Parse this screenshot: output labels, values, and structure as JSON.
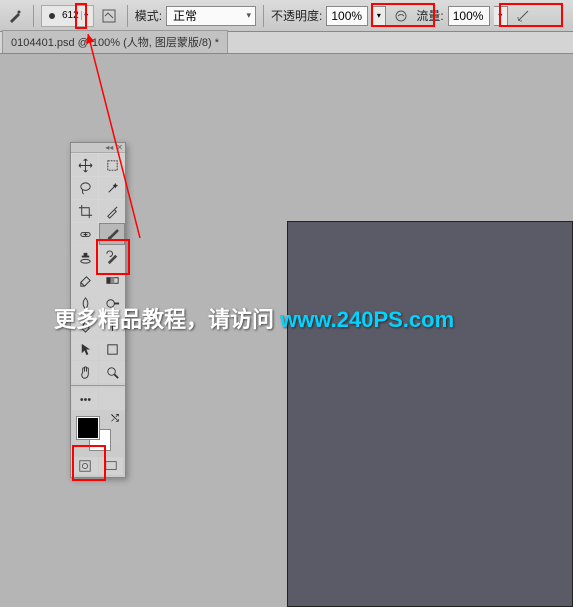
{
  "toolbar": {
    "brush_size": "612",
    "mode_label": "模式:",
    "mode_value": "正常",
    "opacity_label": "不透明度:",
    "opacity_value": "100%",
    "flow_label": "流量:",
    "flow_value": "100%"
  },
  "tab": {
    "title": "0104401.psd @ 100% (人物, 图层蒙版/8) *"
  },
  "tools_panel": {
    "collapse": "◂◂",
    "close": "✕"
  },
  "watermark": {
    "text_cn": "更多精品教程，请访问 ",
    "url_text": "www.240PS.com"
  }
}
